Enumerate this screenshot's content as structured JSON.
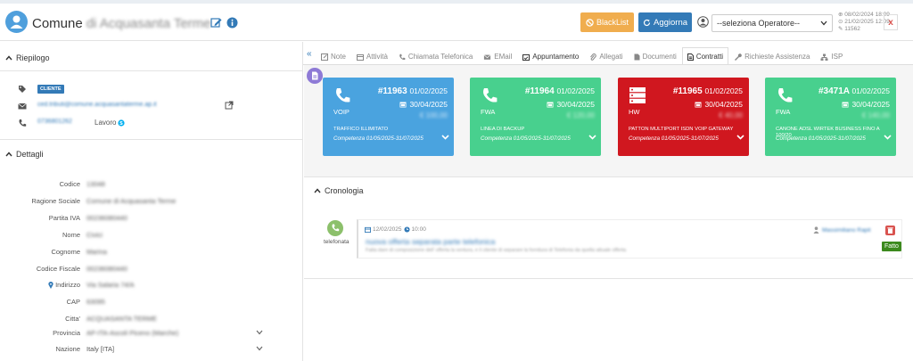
{
  "header": {
    "title_prefix": "Comune",
    "title_name": "di Acquasanta Terme",
    "blacklist_label": "BlackList",
    "refresh_label": "Aggiorna",
    "operator_select": "--seleziona Operatore--",
    "meta_created": "08/02/2024 18:09",
    "meta_updated": "21/02/2025 12:09",
    "meta_id": "11562",
    "close_label": "x"
  },
  "summary": {
    "heading": "Riepilogo",
    "badge": "CLIENTE",
    "email": "ced.tributi@comune.acquasantaterme.ap.it",
    "phone": "0736801262",
    "phone_type": "Lavoro"
  },
  "details": {
    "heading": "Dettagli",
    "rows": [
      {
        "label": "Codice",
        "value": "13048"
      },
      {
        "label": "Ragione Sociale",
        "value": "Comune di Acquasanta Terme"
      },
      {
        "label": "Partita IVA",
        "value": "00236080440"
      },
      {
        "label": "Nome",
        "value": "Civici"
      },
      {
        "label": "Cognome",
        "value": "Marina"
      },
      {
        "label": "Codice Fiscale",
        "value": "00236080440"
      },
      {
        "label": "Indirizzo",
        "value": "Via Salaria 74/A"
      },
      {
        "label": "CAP",
        "value": "63095"
      },
      {
        "label": "Citta'",
        "value": "ACQUASANTA TERME"
      },
      {
        "label": "Provincia",
        "value": "AP-ITA-Ascoli Piceno (Marche)"
      },
      {
        "label": "Nazione",
        "value": "Italy [ITA]"
      }
    ]
  },
  "tabs": [
    {
      "label": "Note"
    },
    {
      "label": "Attività"
    },
    {
      "label": "Chiamata Telefonica"
    },
    {
      "label": "EMail"
    },
    {
      "label": "Appuntamento"
    },
    {
      "label": "Allegati"
    },
    {
      "label": "Documenti"
    },
    {
      "label": "Contratti"
    },
    {
      "label": "Richieste Assistenza"
    },
    {
      "label": "ISP"
    }
  ],
  "active_tab": "Contratti",
  "collapse_glyph": "«",
  "contracts": [
    {
      "type": "VOIP",
      "number": "#11963",
      "start": "01/02/2025",
      "expiry": "30/04/2025",
      "amount": "€ 100,00",
      "desc": "TRAFFICO ILLIMITATO",
      "competence": "Competenza 01/05/2025-31/07/2025",
      "color": "#4aa3df",
      "icon": "phone-icon"
    },
    {
      "type": "FWA",
      "number": "#11964",
      "start": "01/02/2025",
      "expiry": "30/04/2025",
      "amount": "€ 120,00",
      "desc": "LINEA DI BACKUP",
      "competence": "Competenza 01/05/2025-31/07/2025",
      "color": "#48d08e",
      "icon": "phone-icon"
    },
    {
      "type": "HW",
      "number": "#11965",
      "start": "01/02/2025",
      "expiry": "30/04/2025",
      "amount": "€ 40,00",
      "desc": "PATTON MULTIPORT ISDN VOIP GATEWAY",
      "competence": "Competenza 01/05/2025-31/07/2025",
      "color": "#d0171f",
      "icon": "server-icon"
    },
    {
      "type": "FWA",
      "number": "#3471A",
      "start": "01/02/2025",
      "expiry": "30/04/2025",
      "amount": "€ 140,00",
      "desc": "CANONE ADSL WIRTEK BUSINESS FINO A 100/20",
      "competence": "Competenza 01/05/2025-31/07/2025",
      "color": "#48d08e",
      "icon": "phone-icon"
    }
  ],
  "history": {
    "heading": "Cronologia",
    "kind": "telefonata",
    "date": "12/02/2025",
    "time": "10:00",
    "title": "nuova offerta separata parte telefonica",
    "description": "Fatta dare di composizione dell' offerta la ventura, e il cliente di separare la fornitura di Telefonia da quella attuale offerta",
    "operator": "Massimiliano Rapit",
    "status": "Fatto"
  }
}
